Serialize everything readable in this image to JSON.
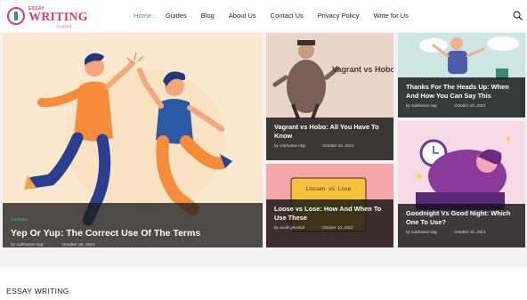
{
  "logo": {
    "small": "ESSAY",
    "main": "WRITING",
    "sub": "GUIDES"
  },
  "nav": [
    {
      "label": "Home",
      "active": true
    },
    {
      "label": "Guides"
    },
    {
      "label": "Blog"
    },
    {
      "label": "About Us"
    },
    {
      "label": "Contact Us"
    },
    {
      "label": "Privacy Policy"
    },
    {
      "label": "Write for Us"
    }
  ],
  "hero": {
    "badge": "GUIDES",
    "title": "Yep Or Yup: The Correct Use Of The Terms",
    "author": "by subhamw nag",
    "date": "October 26, 2021"
  },
  "cards": [
    {
      "image_text": "Vagrant vs Hobo",
      "title": "Vagrant vs Hobo: All You Have To Know",
      "author": "by subhamw nag",
      "date": "October 26, 2021"
    },
    {
      "image_text": "",
      "title": "Thanks For The Heads Up: When And How You Can Say This",
      "author": "by subhamw nag",
      "date": "October 10, 2021"
    },
    {
      "image_text": "Loosen vs Lose",
      "title": "Loose vs Lose: How And When To Use These",
      "author": "by aoxlk ghoskal",
      "date": "October 10, 2021"
    },
    {
      "image_text": "",
      "title": "Goodnight Vs Good Night: Which One To Use?",
      "author": "by subhamw nag",
      "date": "October 10, 2021"
    }
  ],
  "section": {
    "title": "ESSAY WRITING"
  }
}
